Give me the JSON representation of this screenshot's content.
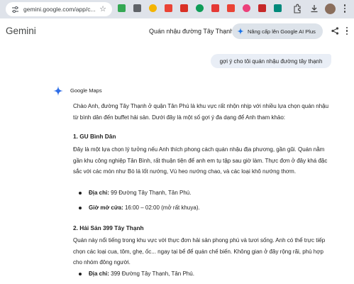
{
  "browser": {
    "url": "gemini.google.com/app/c...",
    "icons": [
      "tune-icon",
      "star-icon",
      "puzzle-icon",
      "download-icon",
      "menu-icon"
    ]
  },
  "extensions": [
    {
      "name": "ext-green-icon",
      "color": "#34a853"
    },
    {
      "name": "ext-gear-icon",
      "color": "#5f6368"
    },
    {
      "name": "ext-rainbow-icon",
      "color": "#f4b400"
    },
    {
      "name": "ext-red-icon",
      "color": "#ea4335"
    },
    {
      "name": "ext-shield-icon",
      "color": "#d93025"
    },
    {
      "name": "ext-green-square-icon",
      "color": "#0f9d58"
    },
    {
      "name": "ext-red-square-icon",
      "color": "#e53935"
    },
    {
      "name": "ext-gmail-icon",
      "color": "#ea4335"
    },
    {
      "name": "ext-pink-check-icon",
      "color": "#ec407a"
    },
    {
      "name": "ext-shield2-icon",
      "color": "#c62828"
    },
    {
      "name": "ext-teal-icon",
      "color": "#00897b"
    }
  ],
  "app": {
    "name": "Gemini",
    "conversation_title": "Quán nhậu đường Tây Thạnh",
    "upgrade_label": "Nâng cấp lên Google AI Plus"
  },
  "user_query": "gợi ý cho tôi quán nhậu đường tây thạnh",
  "response": {
    "tool": "Google Maps",
    "intro": "Chào Anh, đường Tây Thạnh ở quận Tân Phú là khu vực rất nhộn nhịp với nhiều lựa chọn quán nhậu từ bình dân đến buffet hải sản. Dưới đây là một số gợi ý đa dạng để Anh tham khảo:",
    "places": [
      {
        "heading": "1. GU Bình Dân",
        "desc": "Đây là một lựa chọn lý tưởng nếu Anh thích phong cách quán nhậu địa phương, gần gũi. Quán nằm gần khu công nghiệp Tân Bình, rất thuận tiện để anh em tụ tập sau giờ làm. Thực đơn ở đây khá đặc sắc với các món như Bò lá lốt nướng, Vú heo nướng chao, và các loại khô nướng thơm.",
        "address_label": "Địa chỉ:",
        "address": "99 Đường Tây Thạnh, Tân Phú.",
        "hours_label": "Giờ mở cửa:",
        "hours": "16:00 – 02:00 (mở rất khuya)."
      },
      {
        "heading": "2. Hải Sản 399 Tây Thạnh",
        "desc": "Quán này nổi tiếng trong khu vực với thực đơn hải sản phong phú và tươi sống. Anh có thể trực tiếp chọn các loại cua, tôm, ghẹ, ốc... ngay tại bể để quán chế biến. Không gian ở đây rộng rãi, phù hợp cho nhóm đông người.",
        "address_label": "Địa chỉ:",
        "address": "399 Đường Tây Thạnh, Tân Phú."
      }
    ]
  }
}
